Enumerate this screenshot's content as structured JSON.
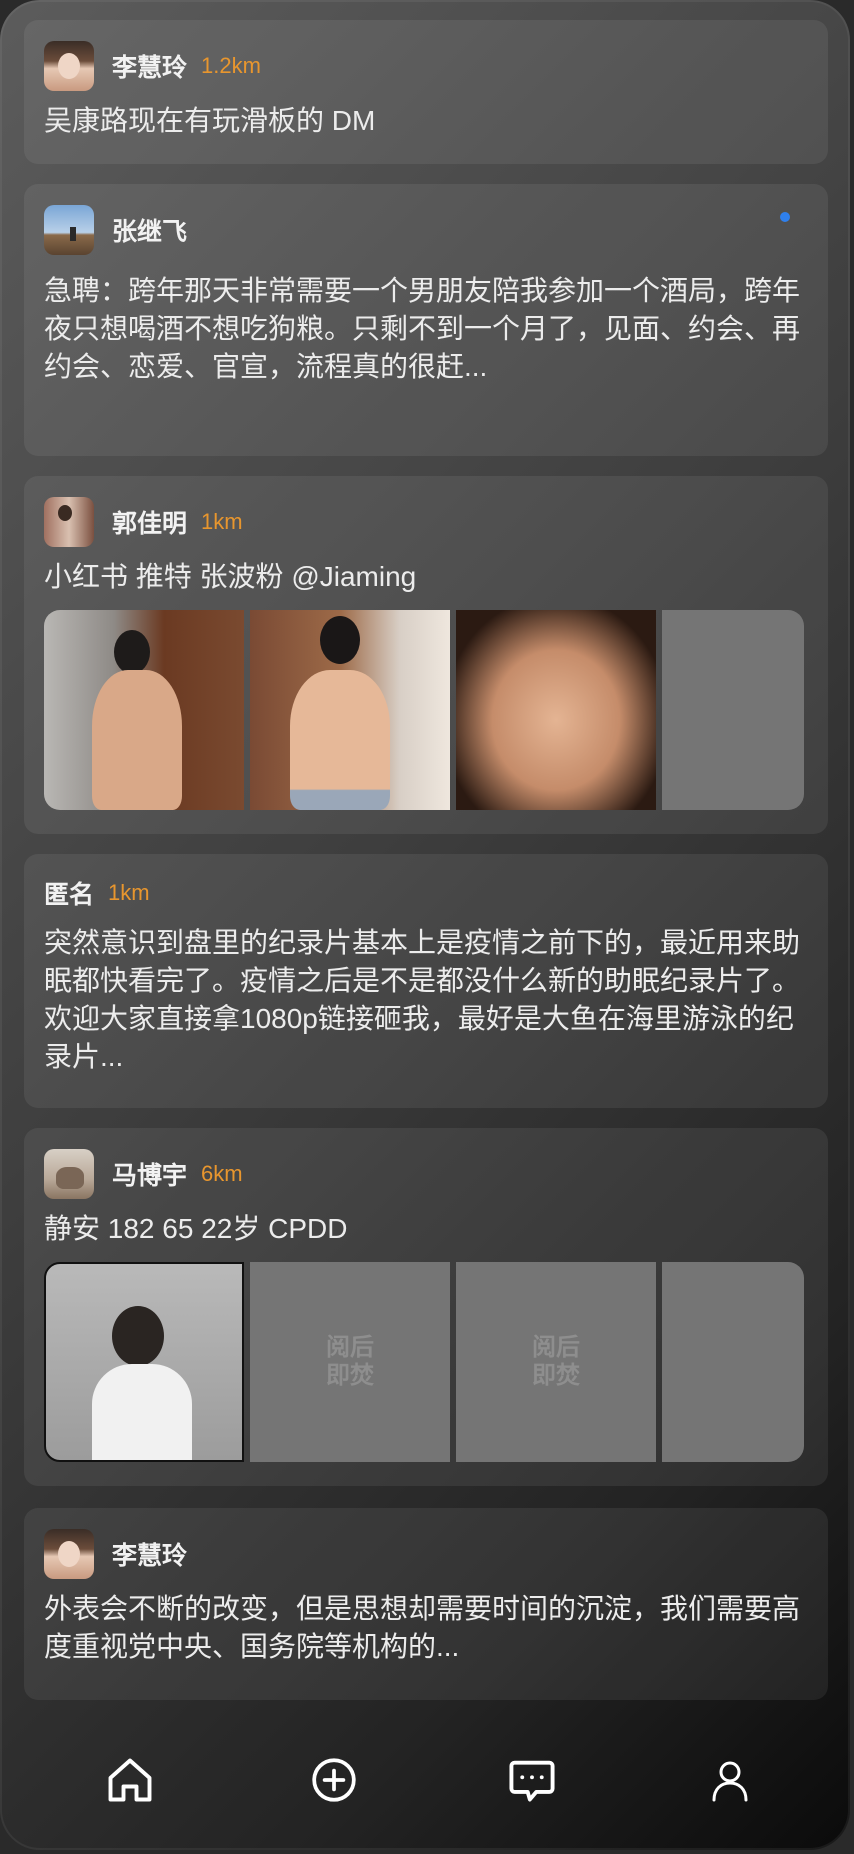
{
  "posts": [
    {
      "name": "李慧玲",
      "distance": "1.2km",
      "text": "吴康路现在有玩滑板的 DM"
    },
    {
      "name": "张继飞",
      "distance": "",
      "text": "急聘：跨年那天非常需要一个男朋友陪我参加一个酒局，跨年夜只想喝酒不想吃狗粮。只剩不到一个月了，见面、约会、再约会、恋爱、官宣，流程真的很赶..."
    },
    {
      "name": "郭佳明",
      "distance": "1km",
      "text": "小红书 推特 张波粉 @Jiaming"
    },
    {
      "name": "匿名",
      "distance": "1km",
      "text": "突然意识到盘里的纪录片基本上是疫情之前下的，最近用来助眠都快看完了。疫情之后是不是都没什么新的助眠纪录片了。欢迎大家直接拿1080p链接砸我，最好是大鱼在海里游泳的纪录片..."
    },
    {
      "name": "马博宇",
      "distance": "6km",
      "text": "静安 182 65 22岁 CPDD",
      "blur_label": "阅后即焚"
    },
    {
      "name": "李慧玲",
      "distance": "",
      "text": "外表会不断的改变，但是思想却需要时间的沉淀，我们需要高度重视党中央、国务院等机构的..."
    }
  ],
  "nav": [
    {
      "icon": "home-icon"
    },
    {
      "icon": "add-circle-icon"
    },
    {
      "icon": "chat-icon"
    },
    {
      "icon": "profile-icon"
    }
  ],
  "colors": {
    "distance": "#e8962e",
    "unread_dot": "#2f80ed"
  }
}
